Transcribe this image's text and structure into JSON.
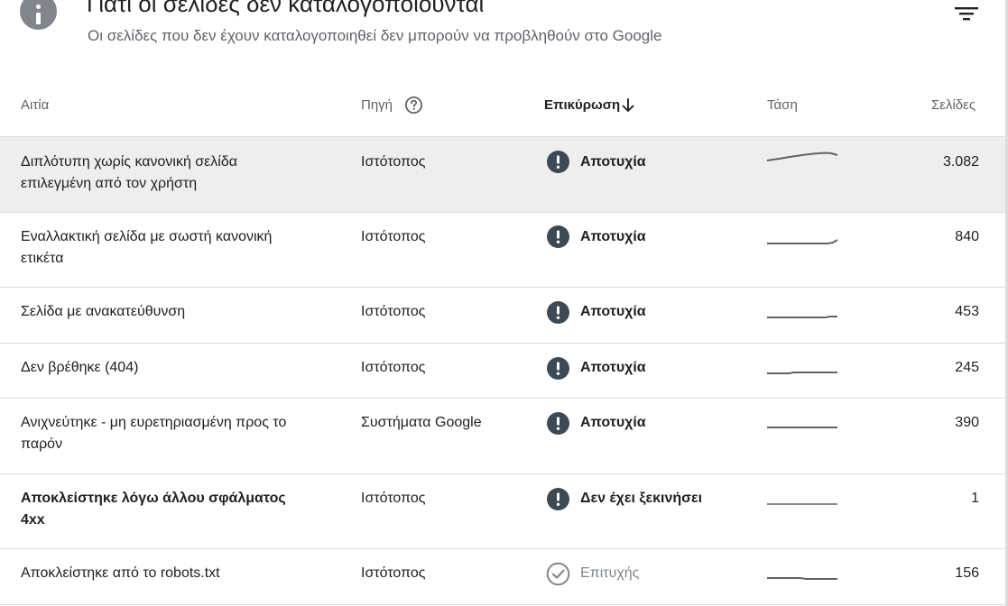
{
  "header": {
    "title": "Γιατί οι σελίδες δεν καταλογοποιούνται",
    "subtitle": "Οι σελίδες που δεν έχουν καταλογοποιηθεί δεν μπορούν να προβληθούν στο Google",
    "info_icon": "info-icon",
    "filter_icon": "filter-list-icon"
  },
  "columns": {
    "reason": "Αιτία",
    "source": "Πηγή",
    "validation": "Επικύρωση",
    "trend": "Τάση",
    "pages": "Σελίδες"
  },
  "colors": {
    "failed": "#3c4a55",
    "passed": "#80868b",
    "trend_line": "#5f6368",
    "row_highlight": "#eeeeee"
  },
  "rows": [
    {
      "reason": "Διπλότυπη χωρίς κανονική σελίδα επιλεγμένη από τον χρήστη",
      "source": "Ιστότοπος",
      "validation": "Αποτυχία",
      "status_icon": "error-icon",
      "pages": "3.082"
    },
    {
      "reason": "Εναλλακτική σελίδα με σωστή κανονική ετικέτα",
      "source": "Ιστότοπος",
      "validation": "Αποτυχία",
      "status_icon": "error-icon",
      "pages": "840"
    },
    {
      "reason": "Σελίδα με ανακατεύθυνση",
      "source": "Ιστότοπος",
      "validation": "Αποτυχία",
      "status_icon": "error-icon",
      "pages": "453"
    },
    {
      "reason": "Δεν βρέθηκε (404)",
      "source": "Ιστότοπος",
      "validation": "Αποτυχία",
      "status_icon": "error-icon",
      "pages": "245"
    },
    {
      "reason": "Ανιχνεύτηκε - μη ευρετηριασμένη προς το παρόν",
      "source": "Συστήματα Google",
      "validation": "Αποτυχία",
      "status_icon": "error-icon",
      "pages": "390"
    },
    {
      "reason": "Αποκλείστηκε λόγω άλλου σφάλματος 4xx",
      "source": "Ιστότοπος",
      "validation": "Δεν έχει ξεκινήσει",
      "status_icon": "error-icon",
      "pages": "1"
    },
    {
      "reason": "Αποκλείστηκε από το robots.txt",
      "source": "Ιστότοπος",
      "validation": "Επιτυχής",
      "status_icon": "check-circle-icon",
      "pages": "156"
    }
  ]
}
